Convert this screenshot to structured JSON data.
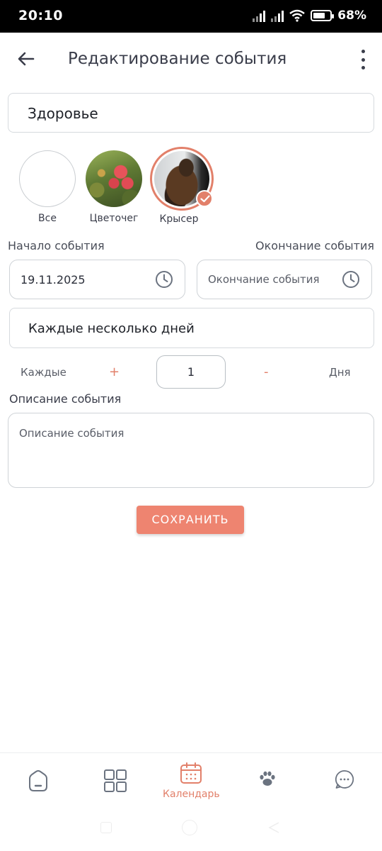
{
  "status_bar": {
    "time": "20:10",
    "battery": "68%"
  },
  "header": {
    "title": "Редактирование события"
  },
  "category": {
    "value": "Здоровье"
  },
  "pets": [
    {
      "label": "Все"
    },
    {
      "label": "Цветочег"
    },
    {
      "label": "Крысер",
      "selected": true
    }
  ],
  "dates": {
    "start_label": "Начало события",
    "end_label": "Окончание события",
    "start_value": "19.11.2025",
    "end_placeholder": "Окончание события"
  },
  "repeat": {
    "mode": "Каждые несколько дней",
    "every_label": "Каждые",
    "plus": "+",
    "value": "1",
    "minus": "-",
    "unit": "Дня"
  },
  "description": {
    "label": "Описание события",
    "placeholder": "Описание события"
  },
  "save_button": "СОХРАНИТЬ",
  "bottom_nav": {
    "items": [
      "home-icon",
      "grid-icon",
      "calendar-icon",
      "paw-icon",
      "chat-icon"
    ],
    "active_label": "Календарь"
  },
  "colors": {
    "accent": "#e2806a",
    "button": "#ee8470",
    "text": "#2b2f3a"
  }
}
